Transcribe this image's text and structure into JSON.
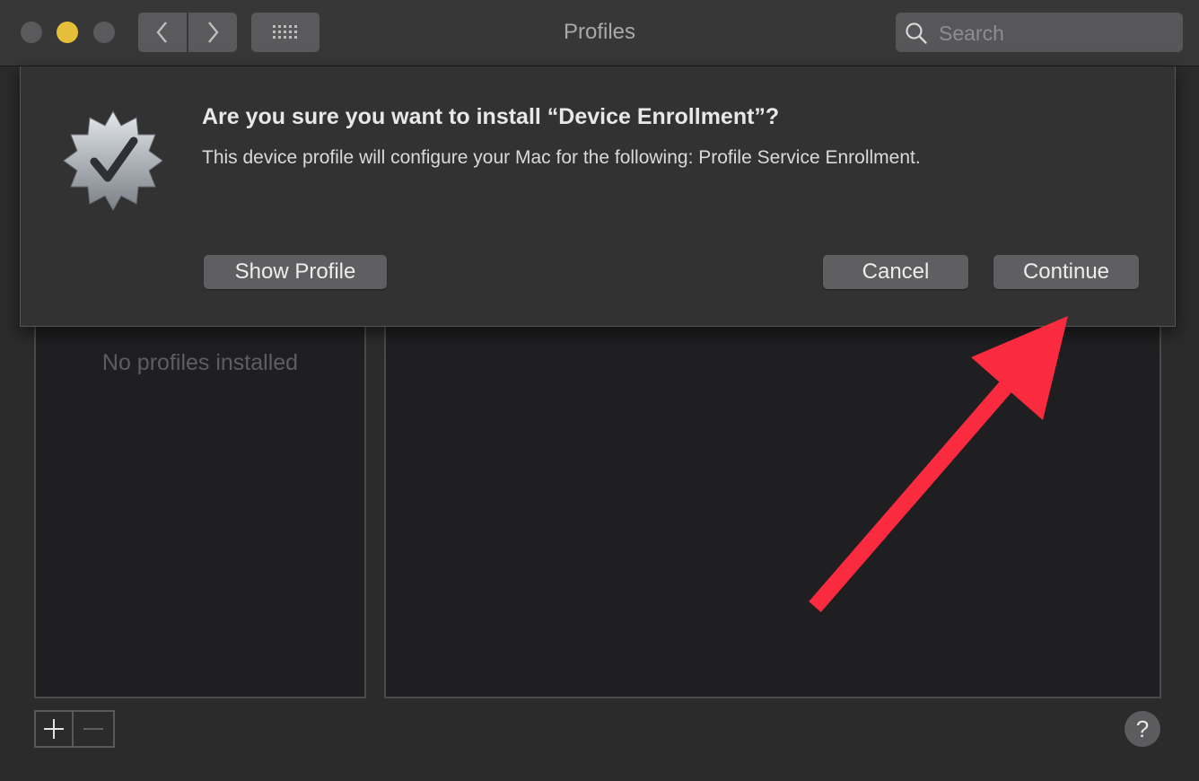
{
  "window": {
    "title": "Profiles",
    "search_placeholder": "Search"
  },
  "toolbar": {
    "icons": [
      "close-light",
      "minimize-light",
      "zoom-light",
      "chevron-left-icon",
      "chevron-right-icon",
      "grid-icon",
      "search-icon"
    ]
  },
  "sidebar": {
    "empty_text": "No profiles installed"
  },
  "sheet": {
    "title": "Are you sure you want to install “Device Enrollment”?",
    "message": "This device profile will configure your Mac for the following: Profile Service Enrollment.",
    "buttons": {
      "show_profile": "Show Profile",
      "cancel": "Cancel",
      "continue": "Continue"
    }
  },
  "footer": {
    "add_label": "+",
    "remove_label": "—",
    "help_label": "?"
  },
  "colors": {
    "minimize_light": "#e6bf3a",
    "annotation_arrow": "#fa2a3f",
    "background": "#2b2b2c"
  }
}
